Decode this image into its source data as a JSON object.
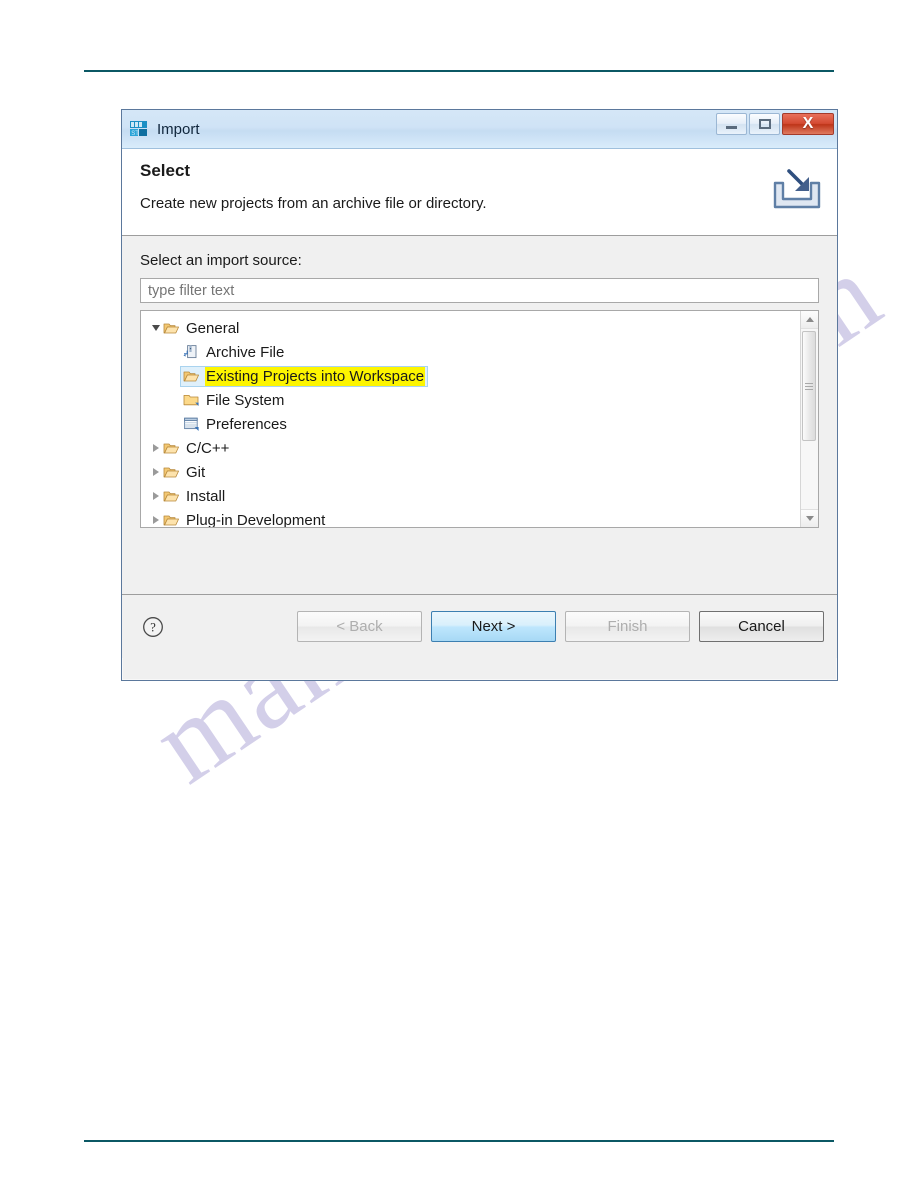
{
  "page": {
    "watermark_text": "manualshive.com",
    "rule_color": "#0b5864"
  },
  "dialog": {
    "titlebar": {
      "title": "Import",
      "app_icon": "stm32-app-icon",
      "minimize_label": "",
      "maximize_label": "",
      "close_label": "X"
    },
    "header": {
      "title": "Select",
      "description": "Create new projects from an archive file or directory.",
      "icon": "import-wizard-icon"
    },
    "body": {
      "source_label": "Select an import source:",
      "filter": {
        "value": "",
        "placeholder": "type filter text"
      },
      "tree": [
        {
          "label": "General",
          "level": 1,
          "expander": "tri-down",
          "icon": "open-folder-icon",
          "selected": false,
          "highlighted": false
        },
        {
          "label": "Archive File",
          "level": 2,
          "expander": "none",
          "icon": "archive-file-icon",
          "selected": false,
          "highlighted": false
        },
        {
          "label": "Existing Projects into Workspace",
          "level": 2,
          "expander": "none",
          "icon": "open-folder-icon",
          "selected": true,
          "highlighted": true
        },
        {
          "label": "File System",
          "level": 2,
          "expander": "none",
          "icon": "closed-folder-icon",
          "selected": false,
          "highlighted": false
        },
        {
          "label": "Preferences",
          "level": 2,
          "expander": "none",
          "icon": "preferences-list-icon",
          "selected": false,
          "highlighted": false
        },
        {
          "label": "C/C++",
          "level": 1,
          "expander": "tri-right",
          "icon": "open-folder-icon",
          "selected": false,
          "highlighted": false
        },
        {
          "label": "Git",
          "level": 1,
          "expander": "tri-right",
          "icon": "open-folder-icon",
          "selected": false,
          "highlighted": false
        },
        {
          "label": "Install",
          "level": 1,
          "expander": "tri-right",
          "icon": "open-folder-icon",
          "selected": false,
          "highlighted": false
        },
        {
          "label": "Plug-in Development",
          "level": 1,
          "expander": "tri-right",
          "icon": "open-folder-icon",
          "selected": false,
          "highlighted": false
        }
      ]
    },
    "footer": {
      "help_icon": "question-mark-icon",
      "buttons": [
        {
          "label": "< Back",
          "state": "disabled"
        },
        {
          "label": "Next >",
          "state": "default"
        },
        {
          "label": "Finish",
          "state": "disabled"
        },
        {
          "label": "Cancel",
          "state": "enabled"
        }
      ]
    }
  },
  "colors": {
    "highlight_yellow": "#fdf500",
    "selection_blue": "#dff0fb",
    "default_button_blue": "#bee6fd",
    "close_red": "#bd3418"
  }
}
